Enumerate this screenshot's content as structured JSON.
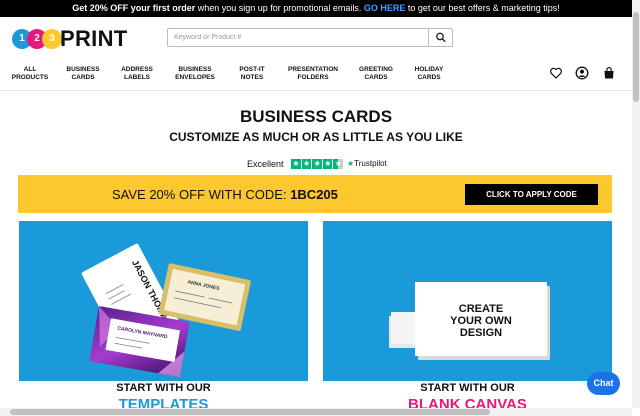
{
  "promo": {
    "bold_start": "Get 20% OFF your first order",
    "middle": " when you sign up for promotional emails. ",
    "link": "GO HERE",
    "end": " to get our best offers & marketing tips!"
  },
  "logo": {
    "digits": [
      "1",
      "2",
      "3"
    ],
    "word": "PRINT"
  },
  "search": {
    "placeholder": "Keyword or Product #",
    "value": ""
  },
  "nav": {
    "items": [
      {
        "line1": "ALL",
        "line2": "PRODUCTS"
      },
      {
        "line1": "BUSINESS",
        "line2": "CARDS"
      },
      {
        "line1": "ADDRESS",
        "line2": "LABELS"
      },
      {
        "line1": "BUSINESS",
        "line2": "ENVELOPES"
      },
      {
        "line1": "POST-IT",
        "line2": "NOTES"
      },
      {
        "line1": "PRESENTATION",
        "line2": "FOLDERS"
      },
      {
        "line1": "GREETING",
        "line2": "CARDS"
      },
      {
        "line1": "HOLIDAY",
        "line2": "CARDS"
      }
    ],
    "icons": [
      "heart-icon",
      "account-icon",
      "bag-icon"
    ]
  },
  "page": {
    "title": "BUSINESS CARDS",
    "subtitle": "CUSTOMIZE AS MUCH OR AS LITTLE AS YOU LIKE"
  },
  "rating": {
    "label": "Excellent",
    "brand": "Trustpilot"
  },
  "promo_code": {
    "text": "SAVE 20% OFF WITH CODE: ",
    "code": "1BC205",
    "button": "CLICK TO APPLY CODE"
  },
  "panels": {
    "left": {
      "cap1": "START WITH OUR",
      "cap2": "TEMPLATES",
      "card_names": [
        "JASON THOMAS",
        "ANNA JONES",
        "CAROLYN MAYNARD"
      ]
    },
    "right": {
      "cap1": "START WITH OUR",
      "cap2": "BLANK CANVAS",
      "card_text": [
        "CREATE",
        "YOUR OWN",
        "DESIGN"
      ]
    }
  },
  "chat": {
    "label": "Chat"
  },
  "colors": {
    "accent_blue": "#1a9ad8",
    "promo_yellow": "#fbc82d",
    "trustpilot_green": "#00b67a",
    "canvas_pink": "#e8187a"
  }
}
